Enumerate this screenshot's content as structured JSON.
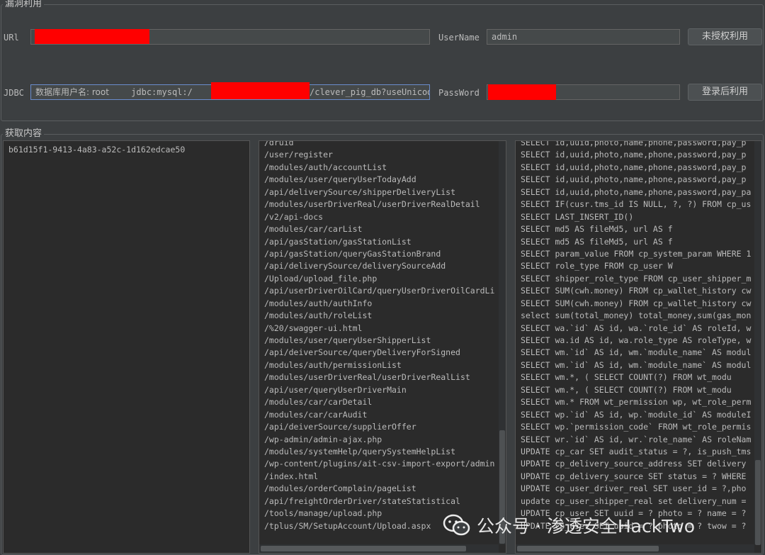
{
  "vuln_section": {
    "title": "漏洞利用",
    "url_label": "URl",
    "url_value": "",
    "jdbc_label": "JDBC",
    "jdbc_value_prefix": "数据库用户名: root",
    "jdbc_value_mid": "jdbc:mysql:/",
    "jdbc_value_suffix": "/clever_pig_db?useUnicod",
    "username_label": "UserName",
    "username_value": "admin",
    "password_label": "PassWord",
    "password_value": "",
    "unauth_button": "未授权利用",
    "login_button": "登录后利用"
  },
  "result_section": {
    "title": "获取内容",
    "left_items": [
      "b61d15f1-9413-4a83-a52c-1d162edcae50"
    ],
    "paths": [
      "/druid",
      "/user/register",
      "/modules/auth/accountList",
      "/modules/user/queryUserTodayAdd",
      "/api/deliverySource/shipperDeliveryList",
      "/modules/userDriverReal/userDriverRealDetail",
      "/v2/api-docs",
      "/modules/car/carList",
      "/api/gasStation/gasStationList",
      "/api/gasStation/queryGasStationBrand",
      "/api/deliverySource/deliverySourceAdd",
      "/Upload/upload_file.php",
      "/api/userDriverOilCard/queryUserDriverOilCardLi",
      "/modules/auth/authInfo",
      "/modules/auth/roleList",
      "/%20/swagger-ui.html",
      "/modules/user/queryUserShipperList",
      "/api/deiverSource/queryDeliveryForSigned",
      "/modules/auth/permissionList",
      "/modules/userDriverReal/userDriverRealList",
      "/api/user/queryUserDriverMain",
      "/modules/car/carDetail",
      "/modules/car/carAudit",
      "/api/deiverSource/supplierOffer",
      "/wp-admin/admin-ajax.php",
      "/modules/systemHelp/querySystemHelpList",
      "/wp-content/plugins/ait-csv-import-export/admin",
      "/index.html",
      "/modules/orderComplain/pageList",
      "/api/freightOrderDriver/stateStatistical",
      "/tools/manage/upload.php",
      "/tplus/SM/SetupAccount/Upload.aspx"
    ],
    "sql": [
      "SELECT  id,uuid,photo,name,phone,password,pay_p",
      "SELECT  id,uuid,photo,name,phone,password,pay_p",
      "SELECT  id,uuid,photo,name,phone,password,pay_p",
      "SELECT  id,uuid,photo,name,phone,password,pay_p",
      "SELECT id,uuid,photo,name,phone,password,pay_pa",
      "SELECT IF(cusr.tms_id IS NULL, ?, ?) FROM cp_us",
      "SELECT LAST_INSERT_ID()",
      "SELECT         md5 AS fileMd5,         url AS f",
      "SELECT         md5 AS fileMd5,         url AS f",
      "SELECT param_value FROM cp_system_param WHERE 1",
      "SELECT role_type         FROM cp_user         W",
      "SELECT shipper_role_type FROM cp_user_shipper_m",
      "SELECT SUM(cwh.money) FROM cp_wallet_history cw",
      "SELECT SUM(cwh.money) FROM cp_wallet_history cw",
      "select sum(total_money) total_money,sum(gas_mon",
      "SELECT wa.`id` AS id, wa.`role_id` AS roleId, w",
      "SELECT wa.id AS id, wa.role_type AS roleType, w",
      "SELECT wm.`id` AS id, wm.`module_name` AS modul",
      "SELECT wm.`id` AS id, wm.`module_name` AS modul",
      "SELECT wm.*, (   SELECT COUNT(?)   FROM wt_modu",
      "SELECT wm.*, (   SELECT COUNT(?)   FROM wt_modu",
      "SELECT wm.* FROM wt_permission wp, wt_role_perm",
      "SELECT wp.`id` AS id, wp.`module_id` AS moduleI",
      "SELECT wp.`permission_code` FROM wt_role_permis",
      "SELECT wr.`id` AS id, wr.`role_name` AS roleNam",
      "UPDATE cp_car SET audit_status = ?, is_push_tms",
      "UPDATE cp_delivery_source_address  SET delivery",
      "UPDATE cp_delivery_source  SET status = ? WHERE",
      "UPDATE cp_user_driver_real  SET user_id = ?,pho",
      "update cp_user_shipper_real set delivery_num =",
      "UPDATE cp_user  SET uuid = ? photo = ? name = ?",
      "UPDATE cp_user  SET uuid = ? photo = ? twow = ?"
    ]
  },
  "watermark": {
    "icon": "wechat-icon",
    "text": "公众号 · 渗透安全HackTwo"
  },
  "colors": {
    "background": "#3c3f41",
    "pane": "#2b2b2b",
    "redaction": "#ff0000",
    "focus_border": "#6a8ccc"
  }
}
